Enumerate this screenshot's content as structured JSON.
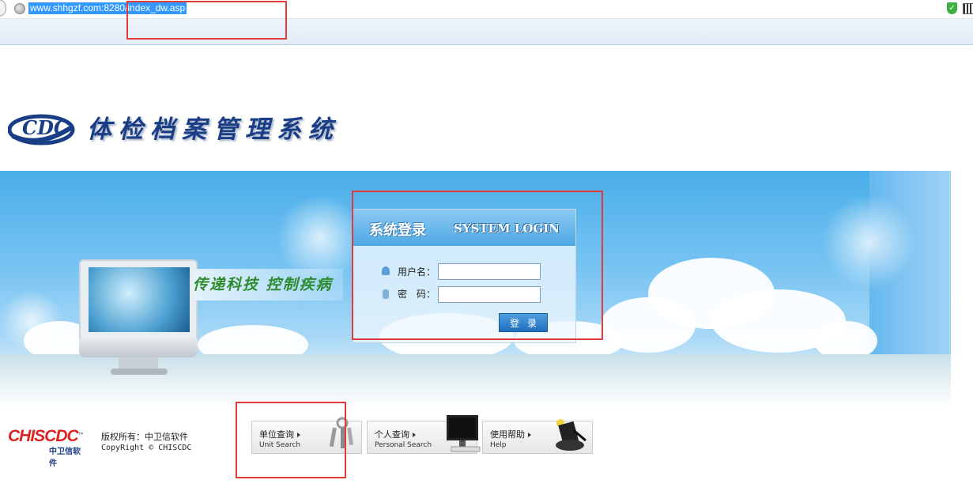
{
  "browser": {
    "url": "www.shhgzf.com:8280/index_dw.asp"
  },
  "header": {
    "title": "体检档案管理系统",
    "logo_text": "CDC"
  },
  "banner": {
    "slogan": "传递科技  控制疾病"
  },
  "login": {
    "title_zh": "系统登录",
    "title_en": "SYSTEM LOGIN",
    "username_label": "用户名：",
    "password_label": "密　码：",
    "username_value": "",
    "password_value": "",
    "submit_label": "登录"
  },
  "footer": {
    "brand": "CHISCDC",
    "brand_tm": "™",
    "brand_sub": "中卫信软件",
    "copyright_zh": "版权所有：中卫信软件",
    "copyright_en": "CopyRight © CHISCDC",
    "buttons": [
      {
        "label_zh": "单位查询",
        "label_en": "Unit Search",
        "icon": "keys-icon"
      },
      {
        "label_zh": "个人查询",
        "label_en": "Personal Search",
        "icon": "monitor-icon"
      },
      {
        "label_zh": "使用帮助",
        "label_en": "Help",
        "icon": "magic-hat-icon"
      }
    ]
  },
  "colors": {
    "annotation": "#e23b3b",
    "brand_blue": "#1a3e86",
    "brand_red": "#dd2222",
    "slogan_green": "#2e8b2e"
  }
}
